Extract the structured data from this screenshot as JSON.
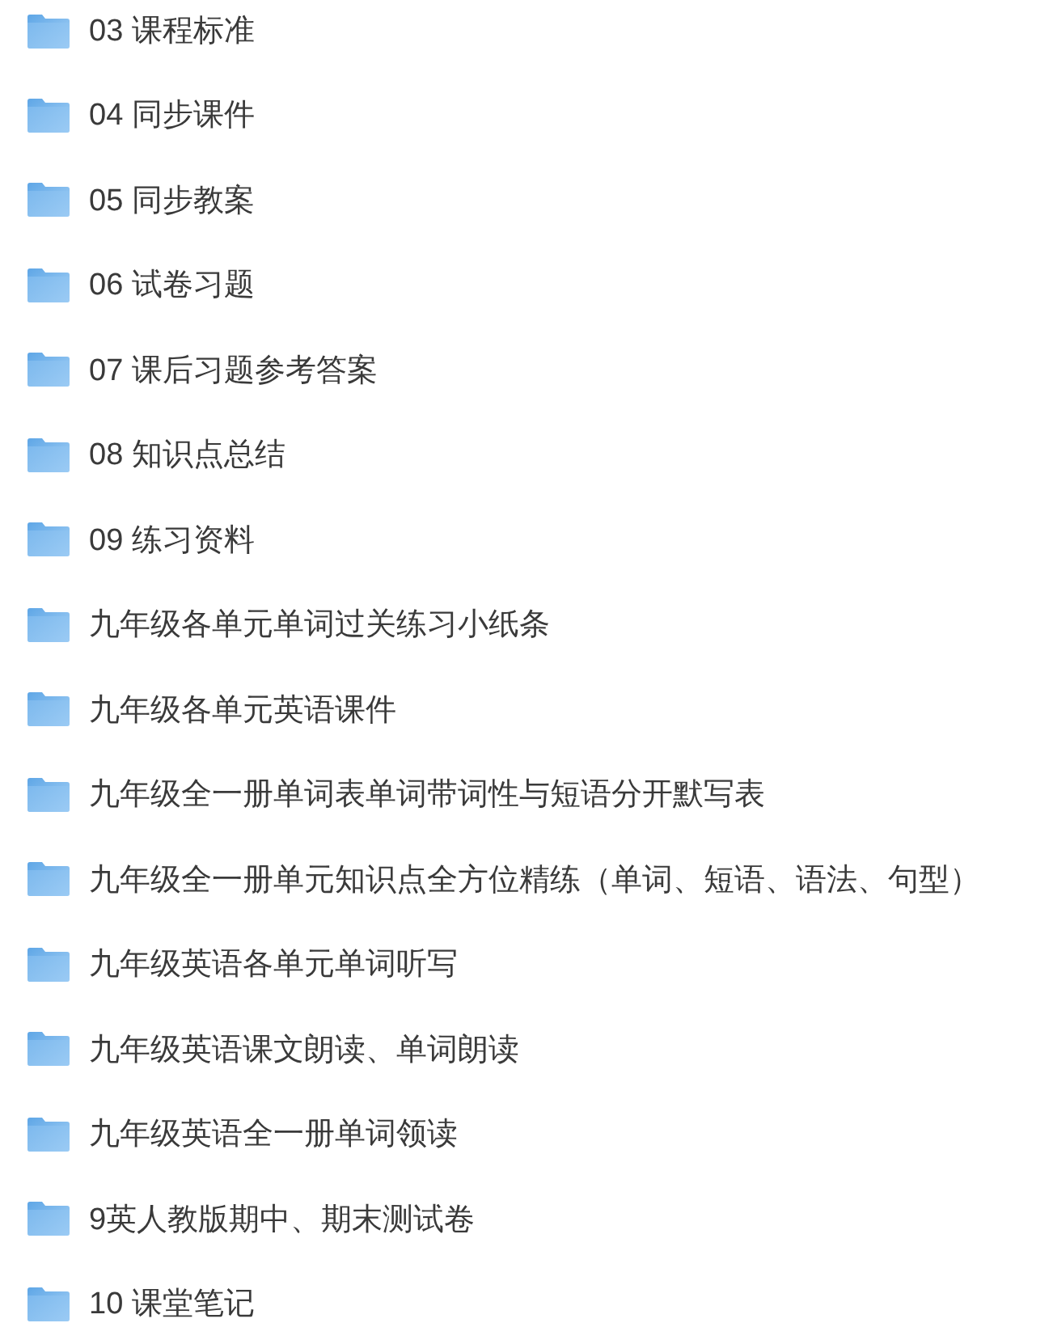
{
  "folders": [
    {
      "name": "03 课程标准"
    },
    {
      "name": "04 同步课件"
    },
    {
      "name": "05 同步教案"
    },
    {
      "name": "06 试卷习题"
    },
    {
      "name": "07 课后习题参考答案"
    },
    {
      "name": "08 知识点总结"
    },
    {
      "name": "09 练习资料"
    },
    {
      "name": "九年级各单元单词过关练习小纸条"
    },
    {
      "name": "九年级各单元英语课件"
    },
    {
      "name": "九年级全一册单词表单词带词性与短语分开默写表"
    },
    {
      "name": "九年级全一册单元知识点全方位精练（单词、短语、语法、句型）"
    },
    {
      "name": "九年级英语各单元单词听写"
    },
    {
      "name": "九年级英语课文朗读、单词朗读"
    },
    {
      "name": "九年级英语全一册单词领读"
    },
    {
      "name": "9英人教版期中、期末测试卷"
    },
    {
      "name": "10 课堂笔记"
    }
  ]
}
